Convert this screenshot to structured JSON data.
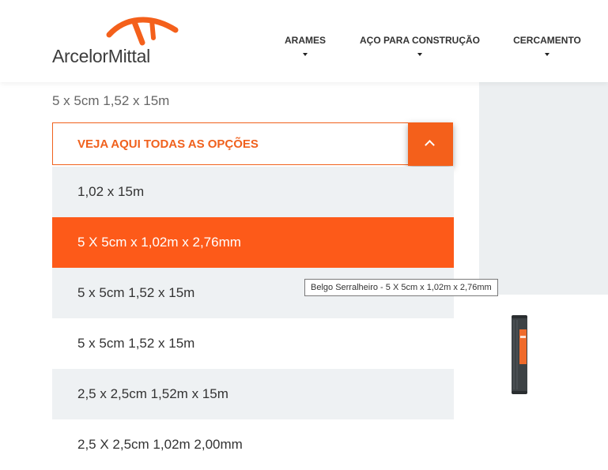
{
  "header": {
    "brand": "ArcelorMittal",
    "nav": [
      {
        "label": "ARAMES"
      },
      {
        "label": "AÇO PARA CONSTRUÇÃO"
      },
      {
        "label": "CERCAMENTO"
      }
    ]
  },
  "product": {
    "subtitle": "5 x 5cm 1,52 x 15m",
    "tooltip": "Belgo Serralheiro - 5 X 5cm x 1,02m x 2,76mm"
  },
  "dropdown": {
    "title": "VEJA AQUI TODAS AS OPÇÕES",
    "options": [
      {
        "label": "1,02 x 15m"
      },
      {
        "label": "5 X 5cm x 1,02m x 2,76mm"
      },
      {
        "label": "5 x 5cm 1,52 x 15m"
      },
      {
        "label": "5 x 5cm 1,52 x 15m"
      },
      {
        "label": "2,5 x 2,5cm 1,52m x 15m"
      },
      {
        "label": "2,5 X 2,5cm 1,02m 2,00mm"
      }
    ]
  },
  "colors": {
    "accent": "#f4601b",
    "selected": "#fd5a19",
    "row_alt": "#eef1f3"
  },
  "icons": {
    "toggle": "chevron-up-icon",
    "nav_caret": "caret-down-icon"
  }
}
